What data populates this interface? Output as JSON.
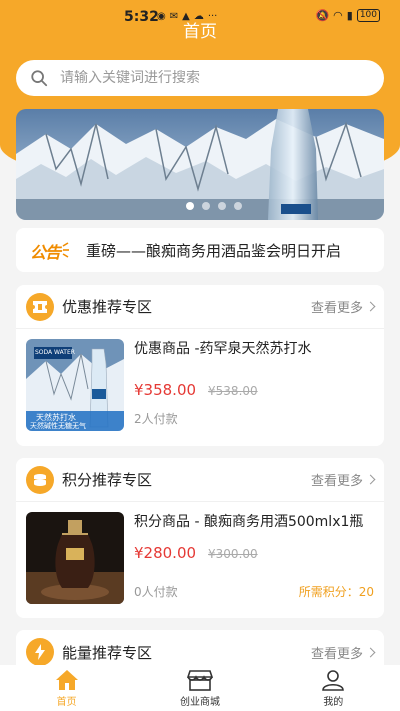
{
  "status_bar": {
    "time": "5:32",
    "battery": "100"
  },
  "header": {
    "title": "首页"
  },
  "search": {
    "placeholder": "请输入关键词进行搜索"
  },
  "notice": {
    "logo_text": "公告",
    "text": "重磅——酿痴商务用酒品鉴会明日开启"
  },
  "sections": [
    {
      "title": "优惠推荐专区",
      "more": "查看更多",
      "icon": "ticket-icon",
      "item": {
        "name": "优惠商品 -药罕泉天然苏打水",
        "price": "¥358.00",
        "old_price": "¥538.00",
        "sold": "2人付款",
        "thumb_caption_1": "天然苏打水",
        "thumb_caption_2": "天然碱性无糖无气",
        "thumb_brand": "SODA WATER"
      }
    },
    {
      "title": "积分推荐专区",
      "more": "查看更多",
      "icon": "coins-icon",
      "item": {
        "name": "积分商品 - 酿痴商务用酒500mlx1瓶",
        "price": "¥280.00",
        "old_price": "¥300.00",
        "sold": "0人付款",
        "points": "所需积分：20"
      }
    },
    {
      "title": "能量推荐专区",
      "more": "查看更多",
      "icon": "lightning-icon"
    }
  ],
  "tabbar": [
    {
      "label": "首页",
      "icon": "home-icon",
      "active": true
    },
    {
      "label": "创业商城",
      "icon": "store-icon",
      "active": false
    },
    {
      "label": "我的",
      "icon": "user-icon",
      "active": false
    }
  ],
  "colors": {
    "accent": "#f6a829",
    "price": "#e53935"
  }
}
